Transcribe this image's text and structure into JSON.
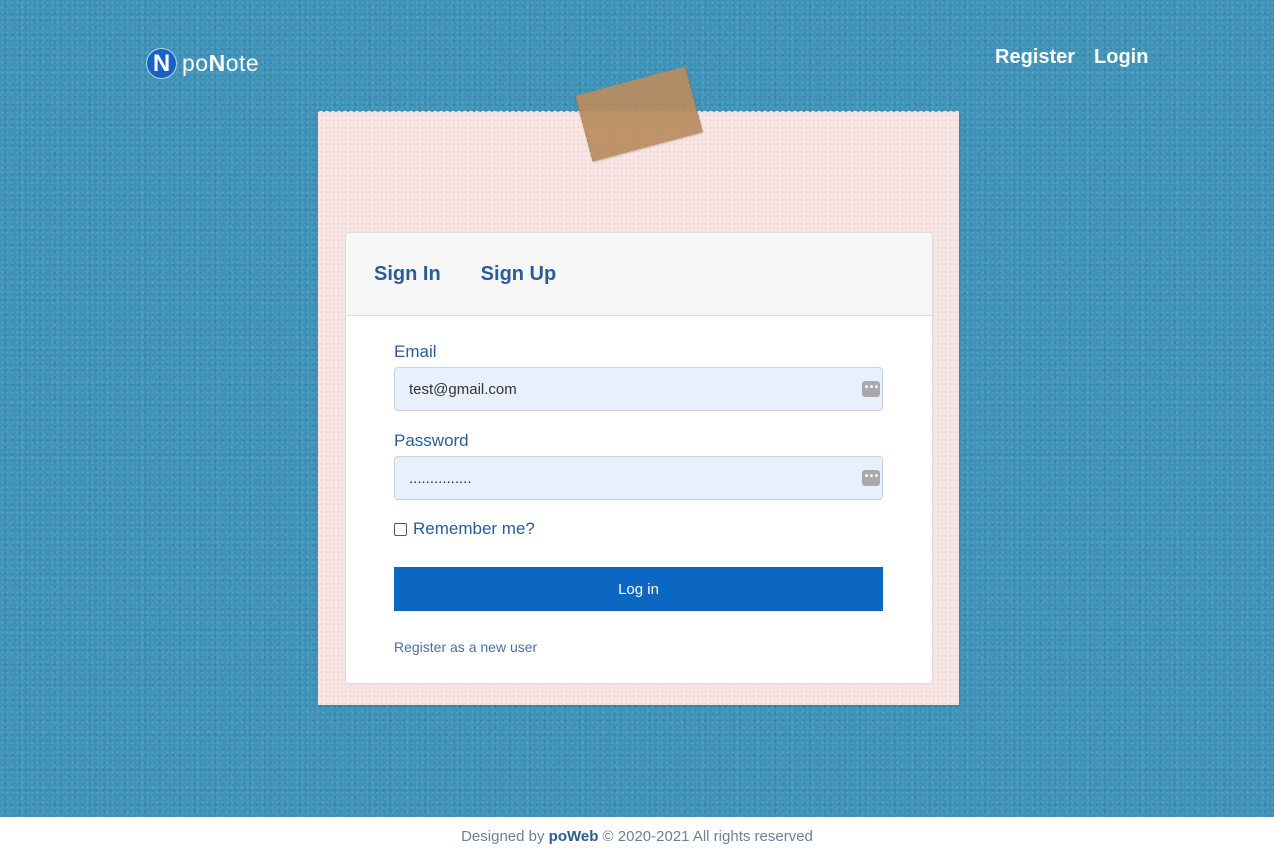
{
  "navbar": {
    "brand_letter": "N",
    "brand_prefix": "po",
    "brand_bold": "N",
    "brand_suffix": "ote",
    "links": [
      "Register",
      "Login"
    ]
  },
  "card": {
    "tabs": [
      "Sign In",
      "Sign Up"
    ],
    "email_label": "Email",
    "email_value": "test@gmail.com",
    "password_label": "Password",
    "password_value": "...............",
    "remember_label": "Remember me?",
    "remember_checked": false,
    "login_button": "Log in",
    "register_link": "Register as a new user"
  },
  "footer": {
    "prefix": "Designed by",
    "brand": "poWeb",
    "suffix": "© 2020-2021 All rights reserved"
  },
  "colors": {
    "background": "#3f93b8",
    "note": "#f6e1df",
    "accent": "#0b67c2",
    "link_text": "#2a5c97"
  },
  "icons": {
    "brand": "ponote-logo-icon",
    "field_key": "password-manager-key-icon"
  }
}
